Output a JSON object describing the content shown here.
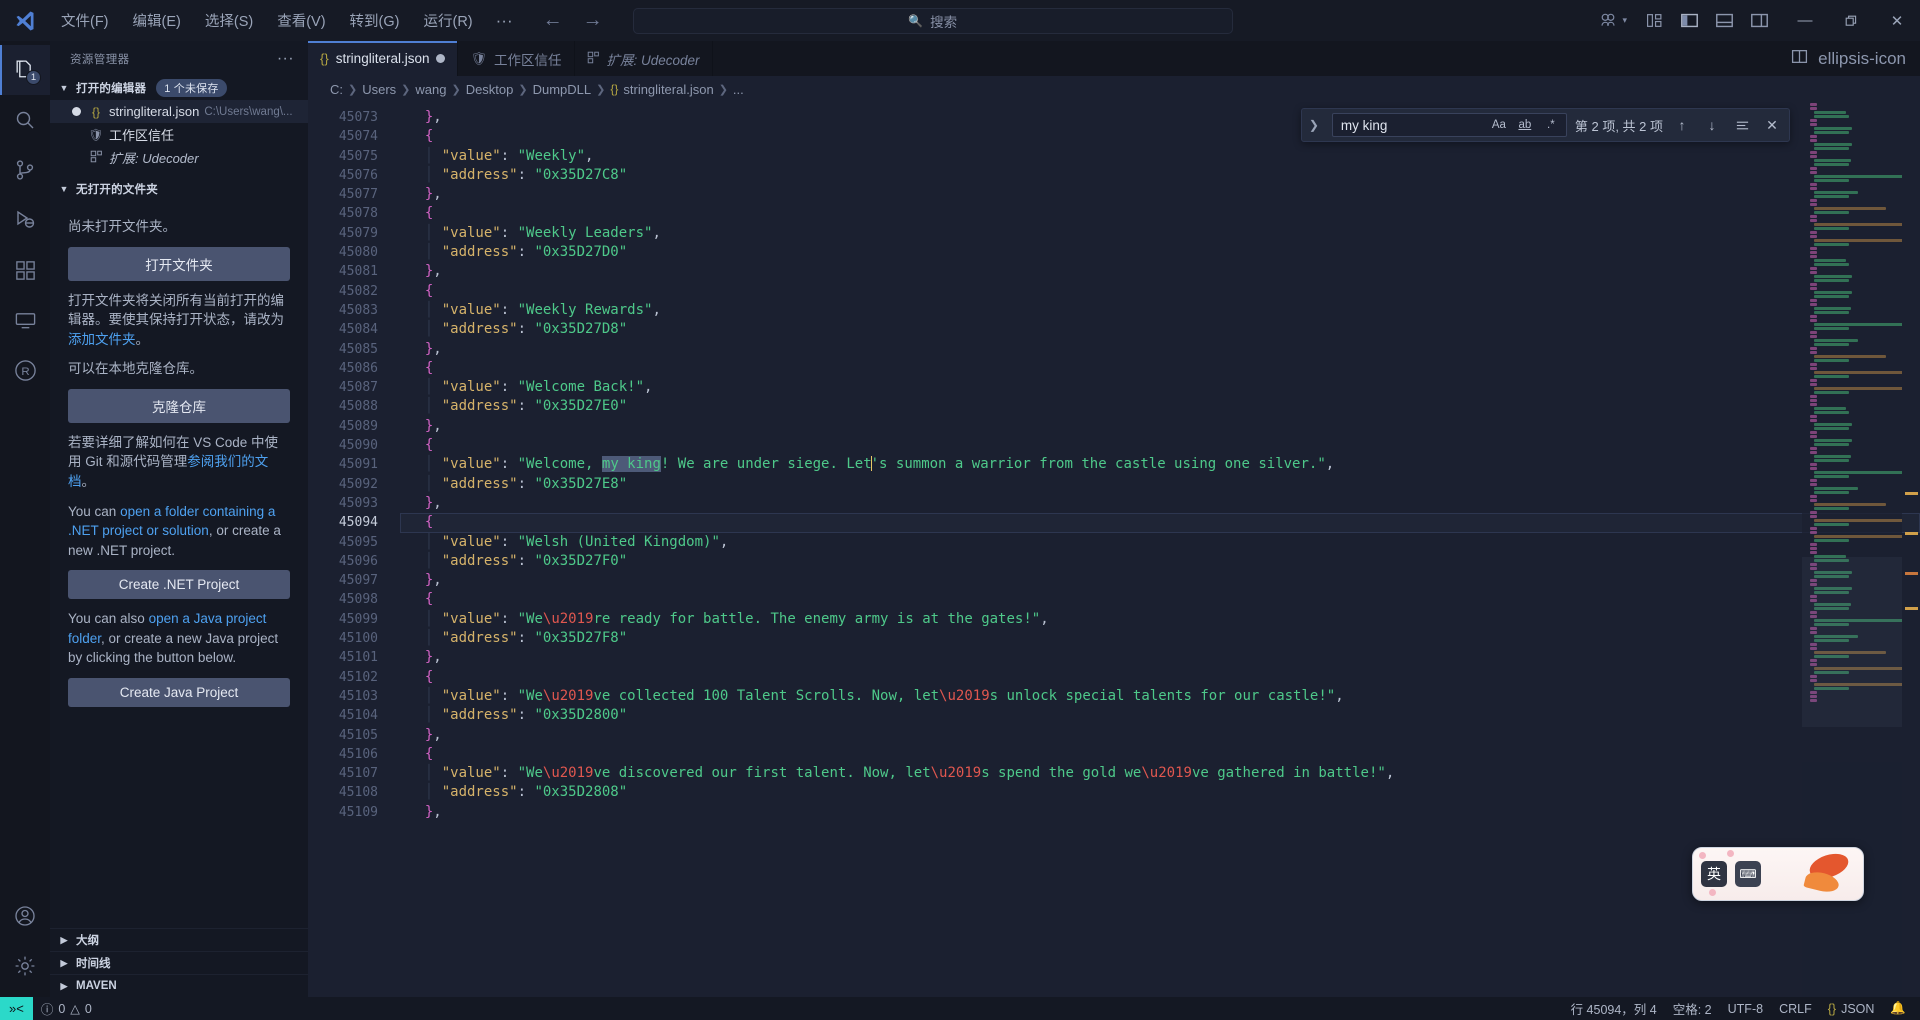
{
  "titlebar": {
    "logo_icon": "vscode-logo-icon",
    "menus": [
      "文件(F)",
      "编辑(E)",
      "选择(S)",
      "查看(V)",
      "转到(G)",
      "运行(R)"
    ],
    "more_label": "···",
    "back_icon": "arrow-left-icon",
    "forward_icon": "arrow-right-icon",
    "command_center_placeholder": "搜索",
    "command_center_icon": "search-icon",
    "accounts_icon": "accounts-icon",
    "layout_icons": [
      "customize-layout-icon",
      "toggle-primary-sidebar-icon",
      "toggle-panel-icon",
      "toggle-secondary-sidebar-icon"
    ],
    "window_minimize": "—",
    "window_restore": "❐",
    "window_close": "✕"
  },
  "activitybar": {
    "items": [
      {
        "name": "explorer",
        "icon": "files-icon",
        "badge": "1",
        "active": true
      },
      {
        "name": "search",
        "icon": "search-icon",
        "badge": "",
        "active": false
      },
      {
        "name": "source-control",
        "icon": "source-control-icon",
        "badge": "",
        "active": false
      },
      {
        "name": "run-and-debug",
        "icon": "run-debug-icon",
        "badge": "",
        "active": false
      },
      {
        "name": "extensions",
        "icon": "extensions-icon",
        "badge": "",
        "active": false
      },
      {
        "name": "remote-explorer",
        "icon": "remote-explorer-icon",
        "badge": "",
        "active": false
      },
      {
        "name": "r-extension",
        "icon": "r-language-icon",
        "badge": "",
        "active": false
      }
    ],
    "bottom": [
      {
        "name": "accounts",
        "icon": "account-circle-icon"
      },
      {
        "name": "settings",
        "icon": "gear-icon"
      }
    ]
  },
  "sidebar": {
    "title": "资源管理器",
    "more_actions_label": "···",
    "open_editors": {
      "header": "打开的编辑器",
      "unsaved_badge": "1 个未保存",
      "items": [
        {
          "icon": "json-icon",
          "name": "stringliteral.json",
          "path": "C:\\Users\\wang\\...",
          "dirty": true,
          "selected": true,
          "italic": false
        },
        {
          "icon": "shield-icon",
          "name": "工作区信任",
          "path": "",
          "dirty": false,
          "selected": false,
          "italic": false
        },
        {
          "icon": "extensions-icon",
          "name": "扩展: Udecoder",
          "path": "",
          "dirty": false,
          "selected": false,
          "italic": true
        }
      ]
    },
    "no_folder": {
      "header": "无打开的文件夹",
      "line1": "尚未打开文件夹。",
      "open_folder_button": "打开文件夹",
      "para2_a": "打开文件夹将关闭所有当前打开的编辑器。要使其保持打开状态，请改为",
      "para2_link": "添加文件夹",
      "para2_b": "。",
      "line3": "可以在本地克隆仓库。",
      "clone_button": "克隆仓库",
      "para4_a": "若要详细了解如何在 VS Code 中使用 Git 和源代码管理",
      "para4_link": "参阅我们的文档",
      "para4_b": "。",
      "para5_a": "You can ",
      "para5_link": "open a folder containing a .NET project or solution",
      "para5_b": ", or create a new .NET project.",
      "dotnet_button": "Create .NET Project",
      "para6_a": "You can also ",
      "para6_link": "open a Java project folder",
      "para6_b": ", or create a new Java project by clicking the button below.",
      "java_button": "Create Java Project"
    },
    "collapsed_sections": [
      "大纲",
      "时间线",
      "MAVEN"
    ]
  },
  "tabs": [
    {
      "icon": "json-icon",
      "label": "stringliteral.json",
      "dirty": true,
      "active": true,
      "italic": false
    },
    {
      "icon": "shield-icon",
      "label": "工作区信任",
      "dirty": false,
      "active": false,
      "italic": false
    },
    {
      "icon": "extensions-icon",
      "label": "扩展: Udecoder",
      "dirty": false,
      "active": false,
      "italic": true
    }
  ],
  "tab_actions": {
    "split_editor_icon": "split-editor-icon",
    "more_icon": "ellipsis-icon"
  },
  "breadcrumbs": [
    "C:",
    "Users",
    "wang",
    "Desktop",
    "DumpDLL",
    "stringliteral.json",
    "..."
  ],
  "find_widget": {
    "toggle_replace_icon": "chevron-right-icon",
    "query": "my king",
    "match_case_label": "Aa",
    "whole_word_label": "ab",
    "regex_label": ".*",
    "match_count": "第 2 项, 共 2 项",
    "prev_icon": "arrow-up-icon",
    "next_icon": "arrow-down-icon",
    "find_in_selection_icon": "find-in-selection-icon",
    "close_icon": "close-icon"
  },
  "editor": {
    "first_line_number": 45073,
    "current_line": 45094,
    "lines": [
      {
        "n": 45073,
        "indent": 1,
        "tokens": [
          {
            "t": "brace",
            "v": "}"
          },
          {
            "t": "punc",
            "v": ","
          }
        ]
      },
      {
        "n": 45074,
        "indent": 1,
        "tokens": [
          {
            "t": "brace",
            "v": "{"
          }
        ]
      },
      {
        "n": 45075,
        "indent": 2,
        "tokens": [
          {
            "t": "key",
            "v": "\"value\""
          },
          {
            "t": "punc",
            "v": ": "
          },
          {
            "t": "str",
            "v": "\"Weekly\""
          },
          {
            "t": "punc",
            "v": ","
          }
        ]
      },
      {
        "n": 45076,
        "indent": 2,
        "tokens": [
          {
            "t": "key",
            "v": "\"address\""
          },
          {
            "t": "punc",
            "v": ": "
          },
          {
            "t": "str",
            "v": "\"0x35D27C8\""
          }
        ]
      },
      {
        "n": 45077,
        "indent": 1,
        "tokens": [
          {
            "t": "brace",
            "v": "}"
          },
          {
            "t": "punc",
            "v": ","
          }
        ]
      },
      {
        "n": 45078,
        "indent": 1,
        "tokens": [
          {
            "t": "brace",
            "v": "{"
          }
        ]
      },
      {
        "n": 45079,
        "indent": 2,
        "tokens": [
          {
            "t": "key",
            "v": "\"value\""
          },
          {
            "t": "punc",
            "v": ": "
          },
          {
            "t": "str",
            "v": "\"Weekly Leaders\""
          },
          {
            "t": "punc",
            "v": ","
          }
        ]
      },
      {
        "n": 45080,
        "indent": 2,
        "tokens": [
          {
            "t": "key",
            "v": "\"address\""
          },
          {
            "t": "punc",
            "v": ": "
          },
          {
            "t": "str",
            "v": "\"0x35D27D0\""
          }
        ]
      },
      {
        "n": 45081,
        "indent": 1,
        "tokens": [
          {
            "t": "brace",
            "v": "}"
          },
          {
            "t": "punc",
            "v": ","
          }
        ]
      },
      {
        "n": 45082,
        "indent": 1,
        "tokens": [
          {
            "t": "brace",
            "v": "{"
          }
        ]
      },
      {
        "n": 45083,
        "indent": 2,
        "tokens": [
          {
            "t": "key",
            "v": "\"value\""
          },
          {
            "t": "punc",
            "v": ": "
          },
          {
            "t": "str",
            "v": "\"Weekly Rewards\""
          },
          {
            "t": "punc",
            "v": ","
          }
        ]
      },
      {
        "n": 45084,
        "indent": 2,
        "tokens": [
          {
            "t": "key",
            "v": "\"address\""
          },
          {
            "t": "punc",
            "v": ": "
          },
          {
            "t": "str",
            "v": "\"0x35D27D8\""
          }
        ]
      },
      {
        "n": 45085,
        "indent": 1,
        "tokens": [
          {
            "t": "brace",
            "v": "}"
          },
          {
            "t": "punc",
            "v": ","
          }
        ]
      },
      {
        "n": 45086,
        "indent": 1,
        "tokens": [
          {
            "t": "brace",
            "v": "{"
          }
        ]
      },
      {
        "n": 45087,
        "indent": 2,
        "tokens": [
          {
            "t": "key",
            "v": "\"value\""
          },
          {
            "t": "punc",
            "v": ": "
          },
          {
            "t": "str",
            "v": "\"Welcome Back!\""
          },
          {
            "t": "punc",
            "v": ","
          }
        ]
      },
      {
        "n": 45088,
        "indent": 2,
        "tokens": [
          {
            "t": "key",
            "v": "\"address\""
          },
          {
            "t": "punc",
            "v": ": "
          },
          {
            "t": "str",
            "v": "\"0x35D27E0\""
          }
        ]
      },
      {
        "n": 45089,
        "indent": 1,
        "tokens": [
          {
            "t": "brace",
            "v": "}"
          },
          {
            "t": "punc",
            "v": ","
          }
        ]
      },
      {
        "n": 45090,
        "indent": 1,
        "tokens": [
          {
            "t": "brace",
            "v": "{"
          }
        ]
      },
      {
        "n": 45091,
        "indent": 2,
        "tokens": [
          {
            "t": "key",
            "v": "\"value\""
          },
          {
            "t": "punc",
            "v": ": "
          },
          {
            "t": "str",
            "v": "\"Welcome, "
          },
          {
            "t": "hl",
            "v": "my king"
          },
          {
            "t": "str",
            "v": "! We are under siege. Let"
          },
          {
            "t": "caret",
            "v": ""
          },
          {
            "t": "str",
            "v": "'s summon a warrior from the castle using one silver.\""
          },
          {
            "t": "punc",
            "v": ","
          }
        ]
      },
      {
        "n": 45092,
        "indent": 2,
        "tokens": [
          {
            "t": "key",
            "v": "\"address\""
          },
          {
            "t": "punc",
            "v": ": "
          },
          {
            "t": "str",
            "v": "\"0x35D27E8\""
          }
        ]
      },
      {
        "n": 45093,
        "indent": 1,
        "tokens": [
          {
            "t": "brace",
            "v": "}"
          },
          {
            "t": "punc",
            "v": ","
          }
        ]
      },
      {
        "n": 45094,
        "indent": 1,
        "tokens": [
          {
            "t": "brace",
            "v": "{"
          }
        ]
      },
      {
        "n": 45095,
        "indent": 2,
        "tokens": [
          {
            "t": "key",
            "v": "\"value\""
          },
          {
            "t": "punc",
            "v": ": "
          },
          {
            "t": "str",
            "v": "\"Welsh (United Kingdom)\""
          },
          {
            "t": "punc",
            "v": ","
          }
        ]
      },
      {
        "n": 45096,
        "indent": 2,
        "tokens": [
          {
            "t": "key",
            "v": "\"address\""
          },
          {
            "t": "punc",
            "v": ": "
          },
          {
            "t": "str",
            "v": "\"0x35D27F0\""
          }
        ]
      },
      {
        "n": 45097,
        "indent": 1,
        "tokens": [
          {
            "t": "brace",
            "v": "}"
          },
          {
            "t": "punc",
            "v": ","
          }
        ]
      },
      {
        "n": 45098,
        "indent": 1,
        "tokens": [
          {
            "t": "brace",
            "v": "{"
          }
        ]
      },
      {
        "n": 45099,
        "indent": 2,
        "tokens": [
          {
            "t": "key",
            "v": "\"value\""
          },
          {
            "t": "punc",
            "v": ": "
          },
          {
            "t": "str",
            "v": "\"We"
          },
          {
            "t": "esc",
            "v": "\\u2019"
          },
          {
            "t": "str",
            "v": "re ready for battle. The enemy army is at the gates!\""
          },
          {
            "t": "punc",
            "v": ","
          }
        ]
      },
      {
        "n": 45100,
        "indent": 2,
        "tokens": [
          {
            "t": "key",
            "v": "\"address\""
          },
          {
            "t": "punc",
            "v": ": "
          },
          {
            "t": "str",
            "v": "\"0x35D27F8\""
          }
        ]
      },
      {
        "n": 45101,
        "indent": 1,
        "tokens": [
          {
            "t": "brace",
            "v": "}"
          },
          {
            "t": "punc",
            "v": ","
          }
        ]
      },
      {
        "n": 45102,
        "indent": 1,
        "tokens": [
          {
            "t": "brace",
            "v": "{"
          }
        ]
      },
      {
        "n": 45103,
        "indent": 2,
        "tokens": [
          {
            "t": "key",
            "v": "\"value\""
          },
          {
            "t": "punc",
            "v": ": "
          },
          {
            "t": "str",
            "v": "\"We"
          },
          {
            "t": "esc",
            "v": "\\u2019"
          },
          {
            "t": "str",
            "v": "ve collected 100 Talent Scrolls. Now, let"
          },
          {
            "t": "esc",
            "v": "\\u2019"
          },
          {
            "t": "str",
            "v": "s unlock special talents for our castle!\""
          },
          {
            "t": "punc",
            "v": ","
          }
        ]
      },
      {
        "n": 45104,
        "indent": 2,
        "tokens": [
          {
            "t": "key",
            "v": "\"address\""
          },
          {
            "t": "punc",
            "v": ": "
          },
          {
            "t": "str",
            "v": "\"0x35D2800\""
          }
        ]
      },
      {
        "n": 45105,
        "indent": 1,
        "tokens": [
          {
            "t": "brace",
            "v": "}"
          },
          {
            "t": "punc",
            "v": ","
          }
        ]
      },
      {
        "n": 45106,
        "indent": 1,
        "tokens": [
          {
            "t": "brace",
            "v": "{"
          }
        ]
      },
      {
        "n": 45107,
        "indent": 2,
        "tokens": [
          {
            "t": "key",
            "v": "\"value\""
          },
          {
            "t": "punc",
            "v": ": "
          },
          {
            "t": "str",
            "v": "\"We"
          },
          {
            "t": "esc",
            "v": "\\u2019"
          },
          {
            "t": "str",
            "v": "ve discovered our first talent. Now, let"
          },
          {
            "t": "esc",
            "v": "\\u2019"
          },
          {
            "t": "str",
            "v": "s spend the gold we"
          },
          {
            "t": "esc",
            "v": "\\u2019"
          },
          {
            "t": "str",
            "v": "ve gathered in battle!\""
          },
          {
            "t": "punc",
            "v": ","
          }
        ]
      },
      {
        "n": 45108,
        "indent": 2,
        "tokens": [
          {
            "t": "key",
            "v": "\"address\""
          },
          {
            "t": "punc",
            "v": ": "
          },
          {
            "t": "str",
            "v": "\"0x35D2808\""
          }
        ]
      },
      {
        "n": 45109,
        "indent": 1,
        "tokens": [
          {
            "t": "brace",
            "v": "}"
          },
          {
            "t": "punc",
            "v": ","
          }
        ]
      }
    ]
  },
  "ime_widget": {
    "mode_label": "英",
    "secondary_icon": "ime-keyboard-icon",
    "art_name": "koi-fish-skin"
  },
  "statusbar": {
    "remote_icon": "remote-window-icon",
    "error_icon": "error-icon",
    "errors": "0",
    "warning_icon": "warning-icon",
    "warnings": "0",
    "cursor_position": "行 45094，列 4",
    "indentation": "空格: 2",
    "encoding": "UTF-8",
    "eol": "CRLF",
    "language_icon": "json-icon",
    "language": "JSON",
    "bell_icon": "bell-icon"
  },
  "colors": {
    "accent": "#4f7fd4",
    "remote_bg": "#2bd9c9",
    "string": "#4ec98a",
    "key": "#d6b36a",
    "brace": "#d363c5",
    "escape": "#e0574f",
    "editor_bg": "#1b2030",
    "sidebar_bg": "#141823"
  }
}
